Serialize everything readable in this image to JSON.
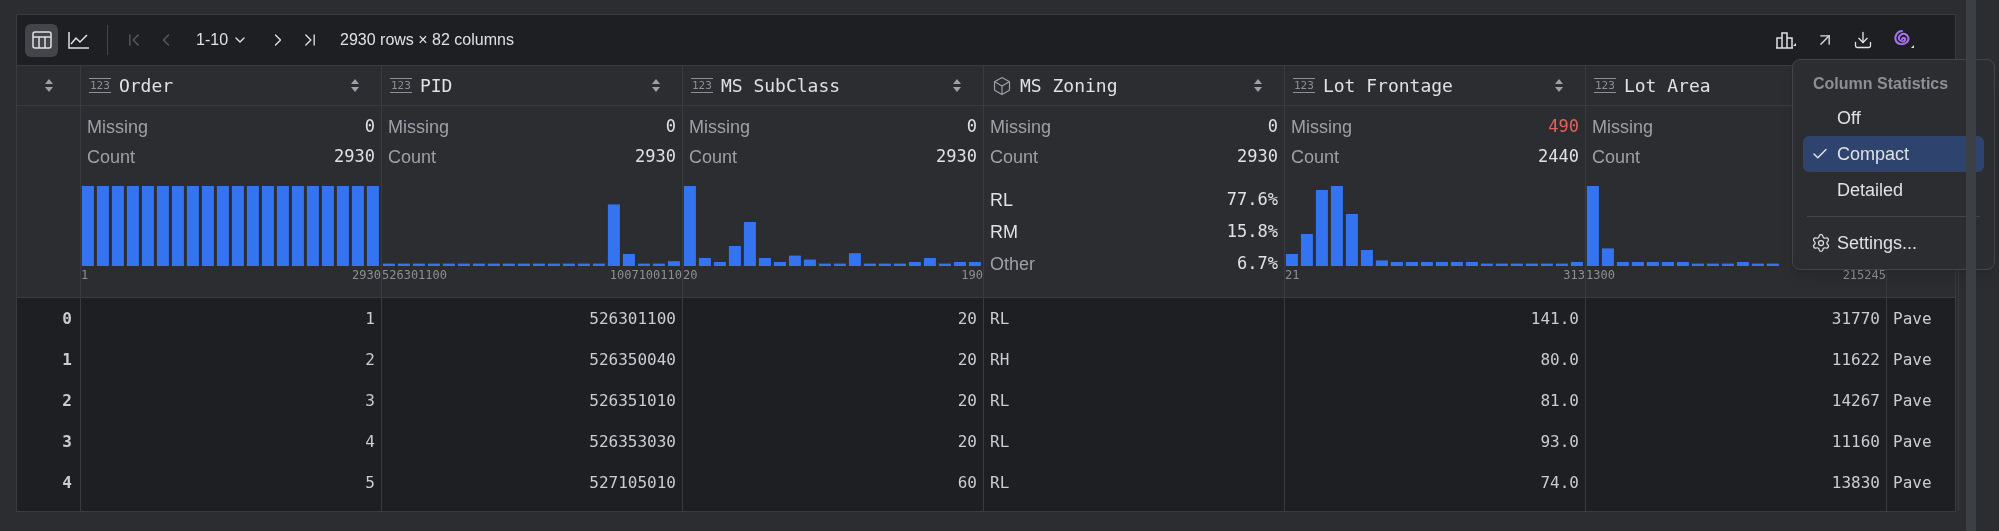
{
  "toolbar": {
    "views": [
      {
        "kind": "table",
        "selected": true
      },
      {
        "kind": "chart",
        "selected": false
      }
    ],
    "nav_before": [
      {
        "kind": "first",
        "disabled": true
      },
      {
        "kind": "prev",
        "disabled": true
      }
    ],
    "page_range": "1-10",
    "nav_after": [
      {
        "kind": "next",
        "disabled": false
      },
      {
        "kind": "last",
        "disabled": false
      }
    ],
    "summary": "2930 rows × 82 columns",
    "actions": [
      {
        "kind": "statistics"
      },
      {
        "kind": "open"
      },
      {
        "kind": "download"
      },
      {
        "kind": "assistant"
      }
    ]
  },
  "columns": [
    {
      "name": "Order",
      "kind": "numeric",
      "type_badge": "123",
      "stats": {
        "missing_label": "Missing",
        "missing": "0",
        "count_label": "Count",
        "count": "2930",
        "range_min": "1",
        "range_max": "2930"
      }
    },
    {
      "name": "PID",
      "kind": "numeric",
      "type_badge": "123",
      "stats": {
        "missing_label": "Missing",
        "missing": "0",
        "count_label": "Count",
        "count": "2930",
        "range_min": "526301100",
        "range_max": "1007100110"
      }
    },
    {
      "name": "MS SubClass",
      "kind": "numeric",
      "type_badge": "123",
      "stats": {
        "missing_label": "Missing",
        "missing": "0",
        "count_label": "Count",
        "count": "2930",
        "range_min": "20",
        "range_max": "190"
      }
    },
    {
      "name": "MS Zoning",
      "kind": "category",
      "stats": {
        "missing_label": "Missing",
        "missing": "0",
        "count_label": "Count",
        "count": "2930",
        "top": [
          {
            "label": "RL",
            "share": "77.6%"
          },
          {
            "label": "RM",
            "share": "15.8%"
          },
          {
            "label": "Other",
            "share": "6.7%"
          }
        ]
      }
    },
    {
      "name": "Lot Frontage",
      "kind": "numeric",
      "type_badge": "123",
      "stats": {
        "missing_label": "Missing",
        "missing": "490",
        "missing_alert": true,
        "count_label": "Count",
        "count": "2440",
        "range_min": "21",
        "range_max": "313"
      }
    },
    {
      "name": "Lot Area",
      "kind": "numeric",
      "type_badge": "123",
      "stats": {
        "missing_label": "Missing",
        "count_label": "Count",
        "range_min": "1300",
        "range_max": "215245"
      }
    },
    {
      "kind": "category"
    }
  ],
  "rows": [
    {
      "index": "0",
      "cells": [
        "1",
        "526301100",
        "20",
        "RL",
        "141.0",
        "31770",
        "Pave"
      ]
    },
    {
      "index": "1",
      "cells": [
        "2",
        "526350040",
        "20",
        "RH",
        "80.0",
        "11622",
        "Pave"
      ]
    },
    {
      "index": "2",
      "cells": [
        "3",
        "526351010",
        "20",
        "RL",
        "81.0",
        "14267",
        "Pave"
      ]
    },
    {
      "index": "3",
      "cells": [
        "4",
        "526353030",
        "20",
        "RL",
        "93.0",
        "11160",
        "Pave"
      ]
    },
    {
      "index": "4",
      "cells": [
        "5",
        "527105010",
        "60",
        "RL",
        "74.0",
        "13830",
        "Pave"
      ]
    }
  ],
  "menu": {
    "title": "Column Statistics",
    "options": [
      {
        "label": "Off",
        "selected": false
      },
      {
        "label": "Compact",
        "selected": true
      },
      {
        "label": "Detailed",
        "selected": false
      }
    ],
    "settings": "Settings..."
  }
}
